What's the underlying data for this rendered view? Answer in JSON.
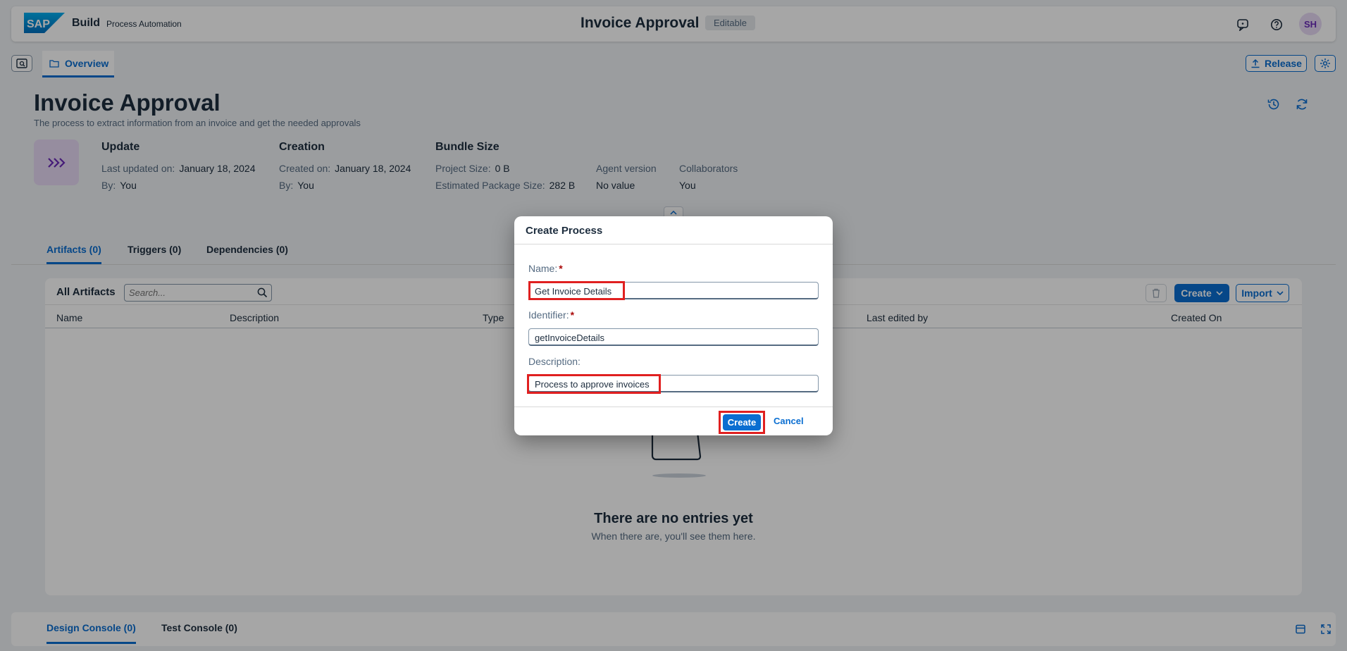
{
  "shell": {
    "logo_text": "SAP",
    "brand": "Build",
    "product": "Process Automation",
    "title": "Invoice Approval",
    "badge": "Editable",
    "avatar": "SH"
  },
  "tabs": {
    "overview": "Overview",
    "release": "Release"
  },
  "header": {
    "title": "Invoice Approval",
    "description": "The process to extract information from an invoice and get the needed approvals",
    "update": {
      "heading": "Update",
      "last_updated_label": "Last updated on:",
      "last_updated_value": "January 18, 2024",
      "by_label": "By:",
      "by_value": "You"
    },
    "creation": {
      "heading": "Creation",
      "created_label": "Created on:",
      "created_value": "January 18, 2024",
      "by_label": "By:",
      "by_value": "You"
    },
    "bundle": {
      "heading": "Bundle Size",
      "project_label": "Project Size:",
      "project_value": "0 B",
      "package_label": "Estimated Package Size:",
      "package_value": "282 B"
    },
    "agent": {
      "label": "Agent version",
      "value": "No value"
    },
    "collaborators": {
      "label": "Collaborators",
      "value": "You"
    }
  },
  "section_tabs": {
    "artifacts": "Artifacts (0)",
    "triggers": "Triggers (0)",
    "dependencies": "Dependencies (0)"
  },
  "artifacts": {
    "title": "All Artifacts",
    "search_placeholder": "Search...",
    "create_label": "Create",
    "import_label": "Import",
    "columns": {
      "name": "Name",
      "description": "Description",
      "type": "Type",
      "last_edited_by": "Last edited by",
      "created_on": "Created On"
    },
    "empty_title": "There are no entries yet",
    "empty_sub": "When there are, you'll see them here."
  },
  "console": {
    "design": "Design Console (0)",
    "test": "Test Console (0)"
  },
  "dialog": {
    "title": "Create Process",
    "name_label": "Name:",
    "name_value": "Get Invoice Details",
    "identifier_label": "Identifier:",
    "identifier_value": "getInvoiceDetails",
    "description_label": "Description:",
    "description_value": "Process to approve invoices",
    "create_label": "Create",
    "cancel_label": "Cancel",
    "required_mark": "*"
  },
  "colors": {
    "accent": "#0a6ed1",
    "highlight": "#e02020",
    "required": "#aa0808"
  }
}
